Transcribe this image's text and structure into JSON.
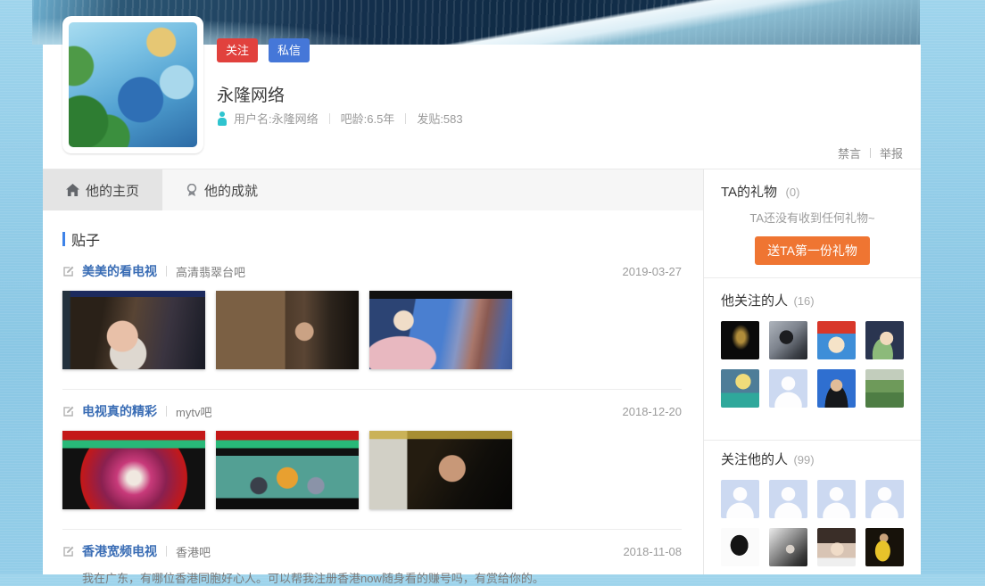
{
  "profile": {
    "avatar_description": "Rio animated movie blue macaw parrots avatar",
    "follow_button": "关注",
    "message_button": "私信",
    "username_title": "永隆网络",
    "stats": [
      {
        "label": "用户名:永隆网络"
      },
      {
        "label": "吧龄:6.5年"
      },
      {
        "label": "发贴:583"
      }
    ],
    "moderation": {
      "mute": "禁言",
      "report": "举报"
    },
    "colors": {
      "follow_red": "#e1413d",
      "message_blue": "#4577d8",
      "gender_teal": "#2fc4cf"
    }
  },
  "tabs": [
    {
      "label": "他的主页",
      "icon": "home-icon",
      "active": true
    },
    {
      "label": "他的成就",
      "icon": "medal-icon",
      "active": false
    }
  ],
  "posts_section": {
    "title": "贴子",
    "accent_color": "#3e83e8"
  },
  "posts": [
    {
      "title": "美美的看电视",
      "forum": "高清翡翠台吧",
      "date": "2019-03-27",
      "thumbnails": [
        "IPTV period-drama actress with channel list overlay",
        "dark bedroom scene with channel menu overlay",
        "news anchor in pink blazer over blue map with channel list"
      ]
    },
    {
      "title": "电视真的精彩",
      "forum": "mytv吧",
      "date": "2018-12-20",
      "thumbnails": [
        "myTV website playing colorful music show 無間音樂",
        "myTV website playing variety talk show with three hosts",
        "dark movie scene with 台湾频道 channel list overlay"
      ]
    },
    {
      "title": "香港宽频电视",
      "forum": "香港吧",
      "date": "2018-11-08",
      "body": "我在广东，有哪位香港同胞好心人。可以帮我注册香港now随身看的赚号吗，有赏给你的。"
    }
  ],
  "sidebar": {
    "gifts": {
      "title": "TA的礼物",
      "count": "(0)",
      "empty_text": "TA还没有收到任何礼物~",
      "button_label": "送TA第一份礼物",
      "button_color": "#ef7532"
    },
    "following": {
      "title": "他关注的人",
      "count": "(16)",
      "avatars": [
        "jordan-jumpman-logo-avatar",
        "man-with-sunglasses-selfie-avatar",
        "red-haired-cartoon-avatar",
        "cartoon-baby-with-glasses-avatar",
        "moon-over-sea-illustration-avatar",
        "default-avatar",
        "young-man-portrait-avatar",
        "green-field-photo-avatar"
      ]
    },
    "followers": {
      "title": "关注他的人",
      "count": "(99)",
      "avatars": [
        "default-avatar",
        "default-avatar",
        "default-avatar",
        "default-avatar",
        "sherlock-silhouette-avatar",
        "black-white-girl-photo-avatar",
        "girl-with-bangs-photo-avatar",
        "bruce-lee-yellow-jumpsuit-avatar"
      ]
    }
  }
}
